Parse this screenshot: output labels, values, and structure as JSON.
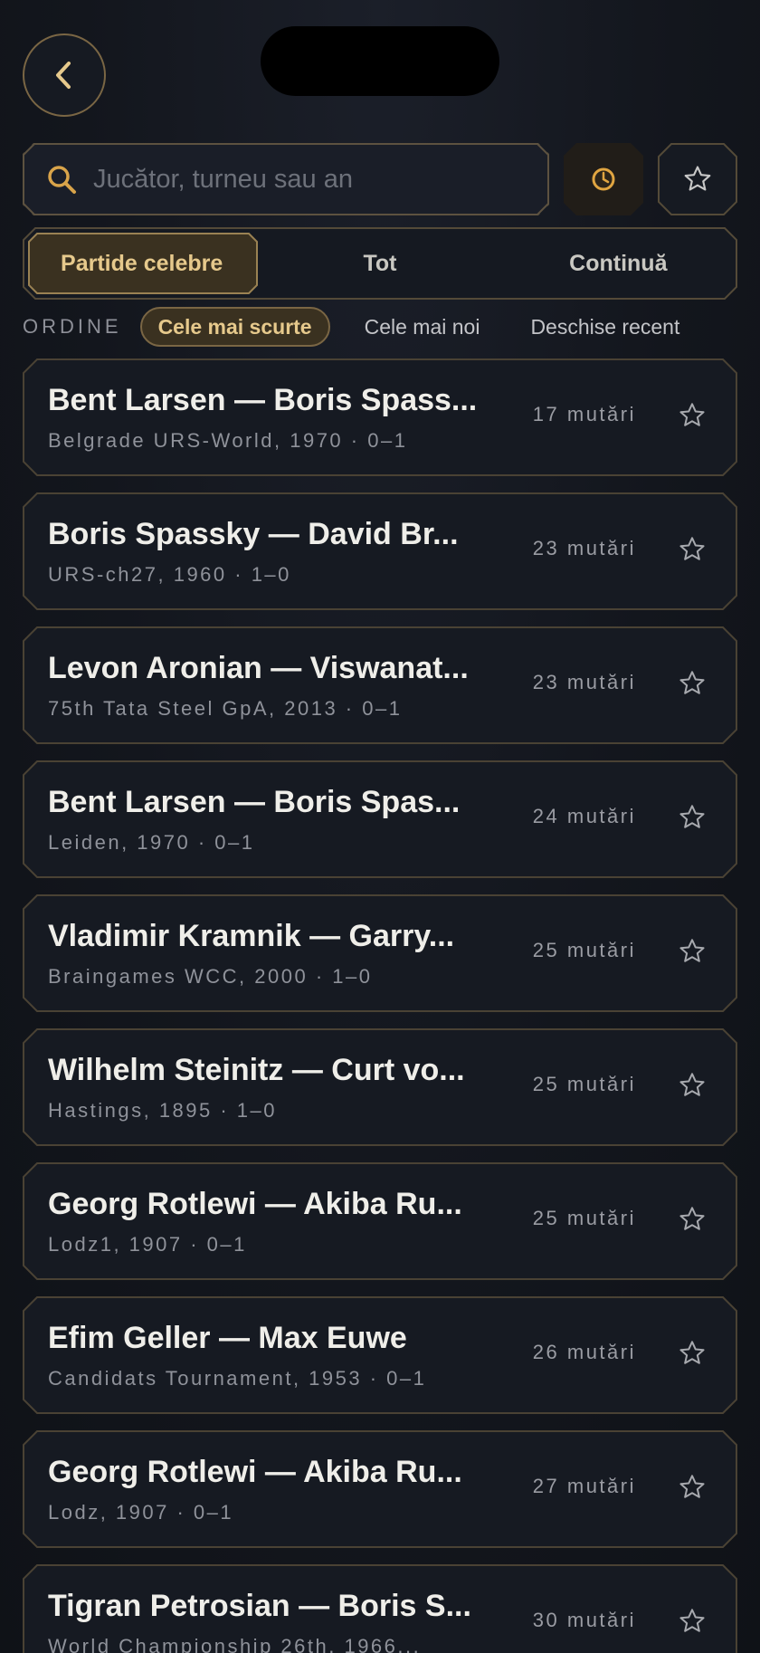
{
  "search": {
    "placeholder": "Jucător, turneu sau an"
  },
  "tabs": [
    {
      "label": "Partide celebre",
      "active": true
    },
    {
      "label": "Tot",
      "active": false
    },
    {
      "label": "Continuă",
      "active": false
    }
  ],
  "order": {
    "label": "ORDINE",
    "options": [
      {
        "label": "Cele mai scurte",
        "active": true
      },
      {
        "label": "Cele mai noi",
        "active": false
      },
      {
        "label": "Deschise recent",
        "active": false
      }
    ]
  },
  "games": [
    {
      "title": "Bent Larsen — Boris Spass...",
      "subtitle": "Belgrade URS-World, 1970 · 0–1",
      "moves": "17 mutări"
    },
    {
      "title": "Boris Spassky — David Br...",
      "subtitle": "URS-ch27, 1960 · 1–0",
      "moves": "23 mutări"
    },
    {
      "title": "Levon Aronian — Viswanat...",
      "subtitle": "75th Tata Steel GpA, 2013 · 0–1",
      "moves": "23 mutări"
    },
    {
      "title": "Bent Larsen — Boris Spas...",
      "subtitle": "Leiden, 1970 · 0–1",
      "moves": "24 mutări"
    },
    {
      "title": "Vladimir Kramnik — Garry...",
      "subtitle": "Braingames WCC, 2000 · 1–0",
      "moves": "25 mutări"
    },
    {
      "title": "Wilhelm Steinitz — Curt vo...",
      "subtitle": "Hastings, 1895 · 1–0",
      "moves": "25 mutări"
    },
    {
      "title": "Georg Rotlewi — Akiba Ru...",
      "subtitle": "Lodz1, 1907 · 0–1",
      "moves": "25 mutări"
    },
    {
      "title": "Efim Geller — Max Euwe",
      "subtitle": "Candidats Tournament, 1953 · 0–1",
      "moves": "26 mutări"
    },
    {
      "title": "Georg Rotlewi — Akiba Ru...",
      "subtitle": "Lodz, 1907 · 0–1",
      "moves": "27 mutări"
    },
    {
      "title": "Tigran Petrosian — Boris S...",
      "subtitle": "World Championship 26th, 1966...",
      "moves": "30 mutări"
    }
  ],
  "colors": {
    "accent": "#e6c98c",
    "border": "#544a38",
    "background": "#12151c"
  }
}
